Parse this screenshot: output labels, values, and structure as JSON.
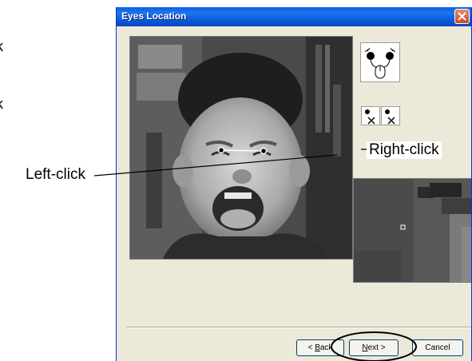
{
  "outside": {
    "cut_label_1": "k",
    "cut_label_2": "k"
  },
  "window": {
    "title": "Eyes Location",
    "close_icon": "close-icon"
  },
  "tools": {
    "mode_icon": "eyes-mouse-click-icon",
    "clear_left_icon": "clear-left-eye-icon",
    "clear_right_icon": "clear-right-eye-icon"
  },
  "buttons": {
    "back": {
      "before": "< ",
      "mnemonic": "B",
      "after": "ack"
    },
    "next": {
      "mnemonic": "N",
      "after": "ext >"
    },
    "cancel": "Cancel"
  },
  "callouts": {
    "left": "Left-click",
    "right": "Right-click"
  },
  "colors": {
    "title_bar": "#0a5fe8",
    "dialog_bg": "#ece9d8",
    "close_button": "#c64b2a"
  }
}
